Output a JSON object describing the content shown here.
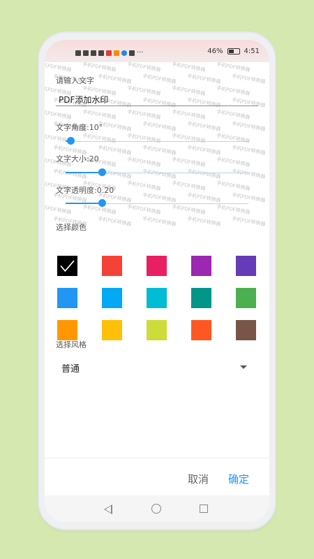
{
  "status_bar": {
    "left_icons": [
      "hd-icon",
      "signal-icon",
      "signal-icon",
      "wifi-icon",
      "app-icon",
      "app-icon",
      "app-icon",
      "app-icon"
    ],
    "more": "···",
    "battery": "46%",
    "time": "4:51"
  },
  "watermark": {
    "text": "手机PDF转换器"
  },
  "input": {
    "label": "请输入文字",
    "value": "PDF添加水印"
  },
  "angle": {
    "label": "文字角度:10°",
    "value": 10,
    "max": 360
  },
  "size": {
    "label": "文字大小:20",
    "value": 20,
    "max": 100
  },
  "opacity": {
    "label": "文字透明度:0.20",
    "value": 0.2,
    "max": 1
  },
  "colors": {
    "label": "选择颜色",
    "swatches": [
      "#000000",
      "#f44336",
      "#e91e63",
      "#9c27b0",
      "#673ab7",
      "#2196f3",
      "#03a9f4",
      "#00bcd4",
      "#009688",
      "#4caf50",
      "#ff9800",
      "#ffc107",
      "#cddc39",
      "#ff5722",
      "#795548"
    ],
    "selected": 0
  },
  "style": {
    "label": "选择风格",
    "value": "普通"
  },
  "actions": {
    "cancel": "取消",
    "confirm": "确定",
    "cancel_color": "#666666",
    "confirm_color": "#2196f3"
  }
}
